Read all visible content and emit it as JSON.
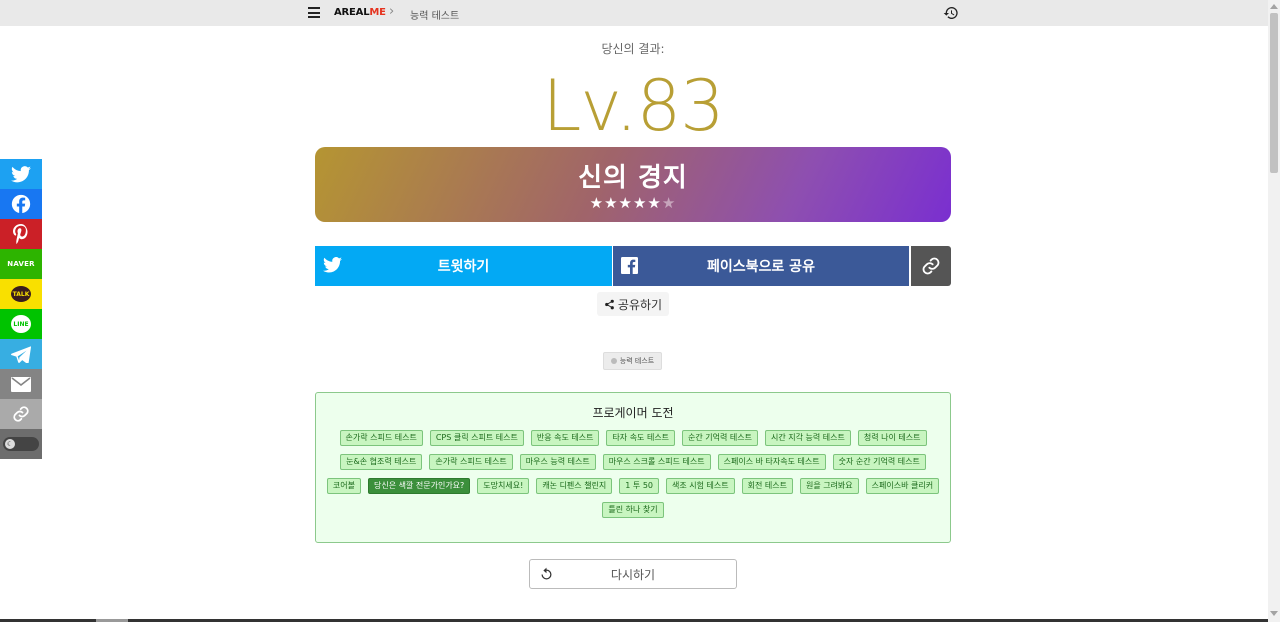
{
  "header": {
    "logo_main": "AREAL",
    "logo_accent": "ME",
    "breadcrumb_sep": "›",
    "breadcrumb": "능력 테스트"
  },
  "result": {
    "label": "당신의 결과:",
    "level": "Lv.83",
    "rank_title": "신의 경지",
    "stars_filled": "★★★★★",
    "stars_empty": "★",
    "star_rating": 5,
    "star_max": 6
  },
  "share": {
    "tweet_label": "트윗하기",
    "facebook_label": "페이스북으로 공유",
    "more_label": "공유하기",
    "naver_label": "NAVER",
    "talk_label": "TALK",
    "line_label": "LINE"
  },
  "tag": {
    "label": "능력 테스트"
  },
  "challenge": {
    "title": "프로게이머 도전",
    "links": [
      "손가락 스피드 테스트",
      "CPS 클릭 스피트 테스트",
      "반응 속도 테스트",
      "타자 속도 테스트",
      "순간 기억력 테스트",
      "시간 지각 능력 테스트",
      "청력 나이 테스트",
      "눈&손 협조력 테스트",
      "손가락 스피드 테스트",
      "마우스 능력 테스트",
      "마우스 스크롤 스피드 테스트",
      "스페이스 바 타자속도 테스트",
      "숫자 순간 기억력 테스트",
      "코어볼",
      "당신은 색깔 전문가인가요?",
      "도망치세요!",
      "캐논 디펜스 챌린지",
      "1 투 50",
      "색조 시험 테스트",
      "회전 테스트",
      "원을 그려봐요",
      "스페이스바 클리커",
      "틀린 하나 찾기"
    ],
    "active_index": 14
  },
  "retry": {
    "label": "다시하기"
  },
  "colors": {
    "level_gold": "#b89f35",
    "twitter_blue": "#03a9f4",
    "facebook_blue": "#3b5998",
    "challenge_bg": "#edffed",
    "active_chip": "#3b8f3b"
  },
  "icons": [
    "menu-icon",
    "history-icon",
    "twitter-icon",
    "facebook-icon",
    "pinterest-icon",
    "telegram-icon",
    "email-icon",
    "link-icon",
    "share-icon",
    "refresh-icon",
    "moon-icon"
  ]
}
